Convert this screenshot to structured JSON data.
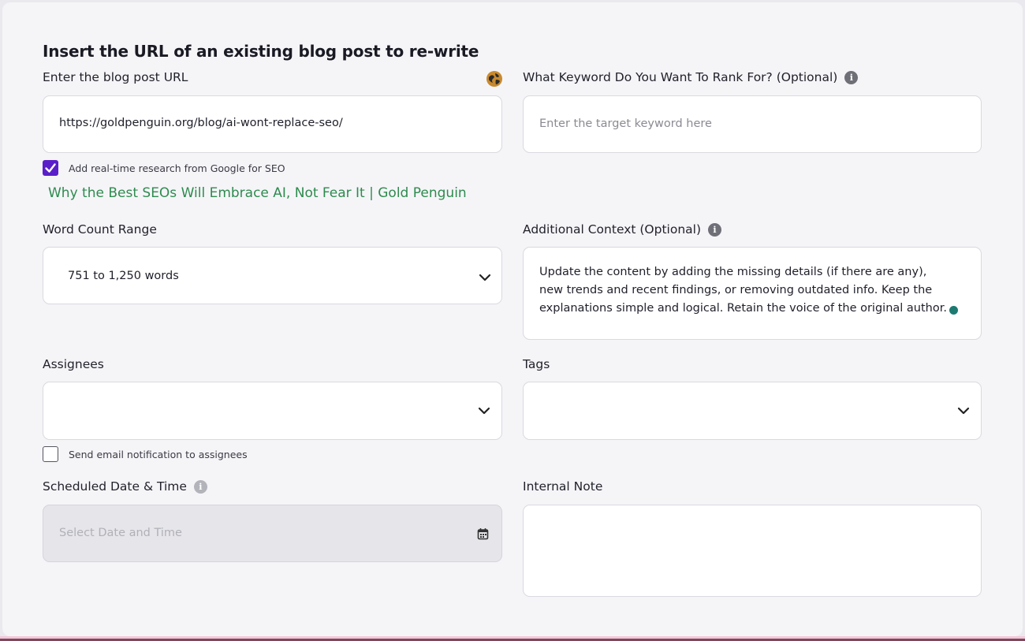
{
  "form": {
    "heading": "Insert the URL of an existing blog post to re-write",
    "url": {
      "label": "Enter the blog post URL",
      "value": "https://goldpenguin.org/blog/ai-wont-replace-seo/",
      "favicon": "globe-icon"
    },
    "keyword": {
      "label": "What Keyword Do You Want To Rank For? (Optional)",
      "placeholder": "Enter the target keyword here"
    },
    "research": {
      "label": "Add real-time research from Google for SEO",
      "checked": true
    },
    "article_title": "Why the Best SEOs Will Embrace AI, Not Fear It | Gold Penguin",
    "word_count": {
      "label": "Word Count Range",
      "value": "751 to 1,250 words"
    },
    "context": {
      "label": "Additional Context (Optional)",
      "value": "Update the content by adding the missing details (if there are any), new trends and recent findings, or removing outdated info. Keep the explanations simple and logical. Retain the voice of the original author."
    },
    "assignees": {
      "label": "Assignees",
      "value": ""
    },
    "tags": {
      "label": "Tags",
      "value": ""
    },
    "notify": {
      "label": "Send email notification to assignees",
      "checked": false
    },
    "schedule": {
      "label": "Scheduled Date & Time",
      "placeholder": "Select Date and Time"
    },
    "note": {
      "label": "Internal Note",
      "value": ""
    }
  },
  "colors": {
    "accent_purple": "#5b1fc9",
    "link_green": "#2e8b4e",
    "grammar_dot": "#1d7a70"
  }
}
